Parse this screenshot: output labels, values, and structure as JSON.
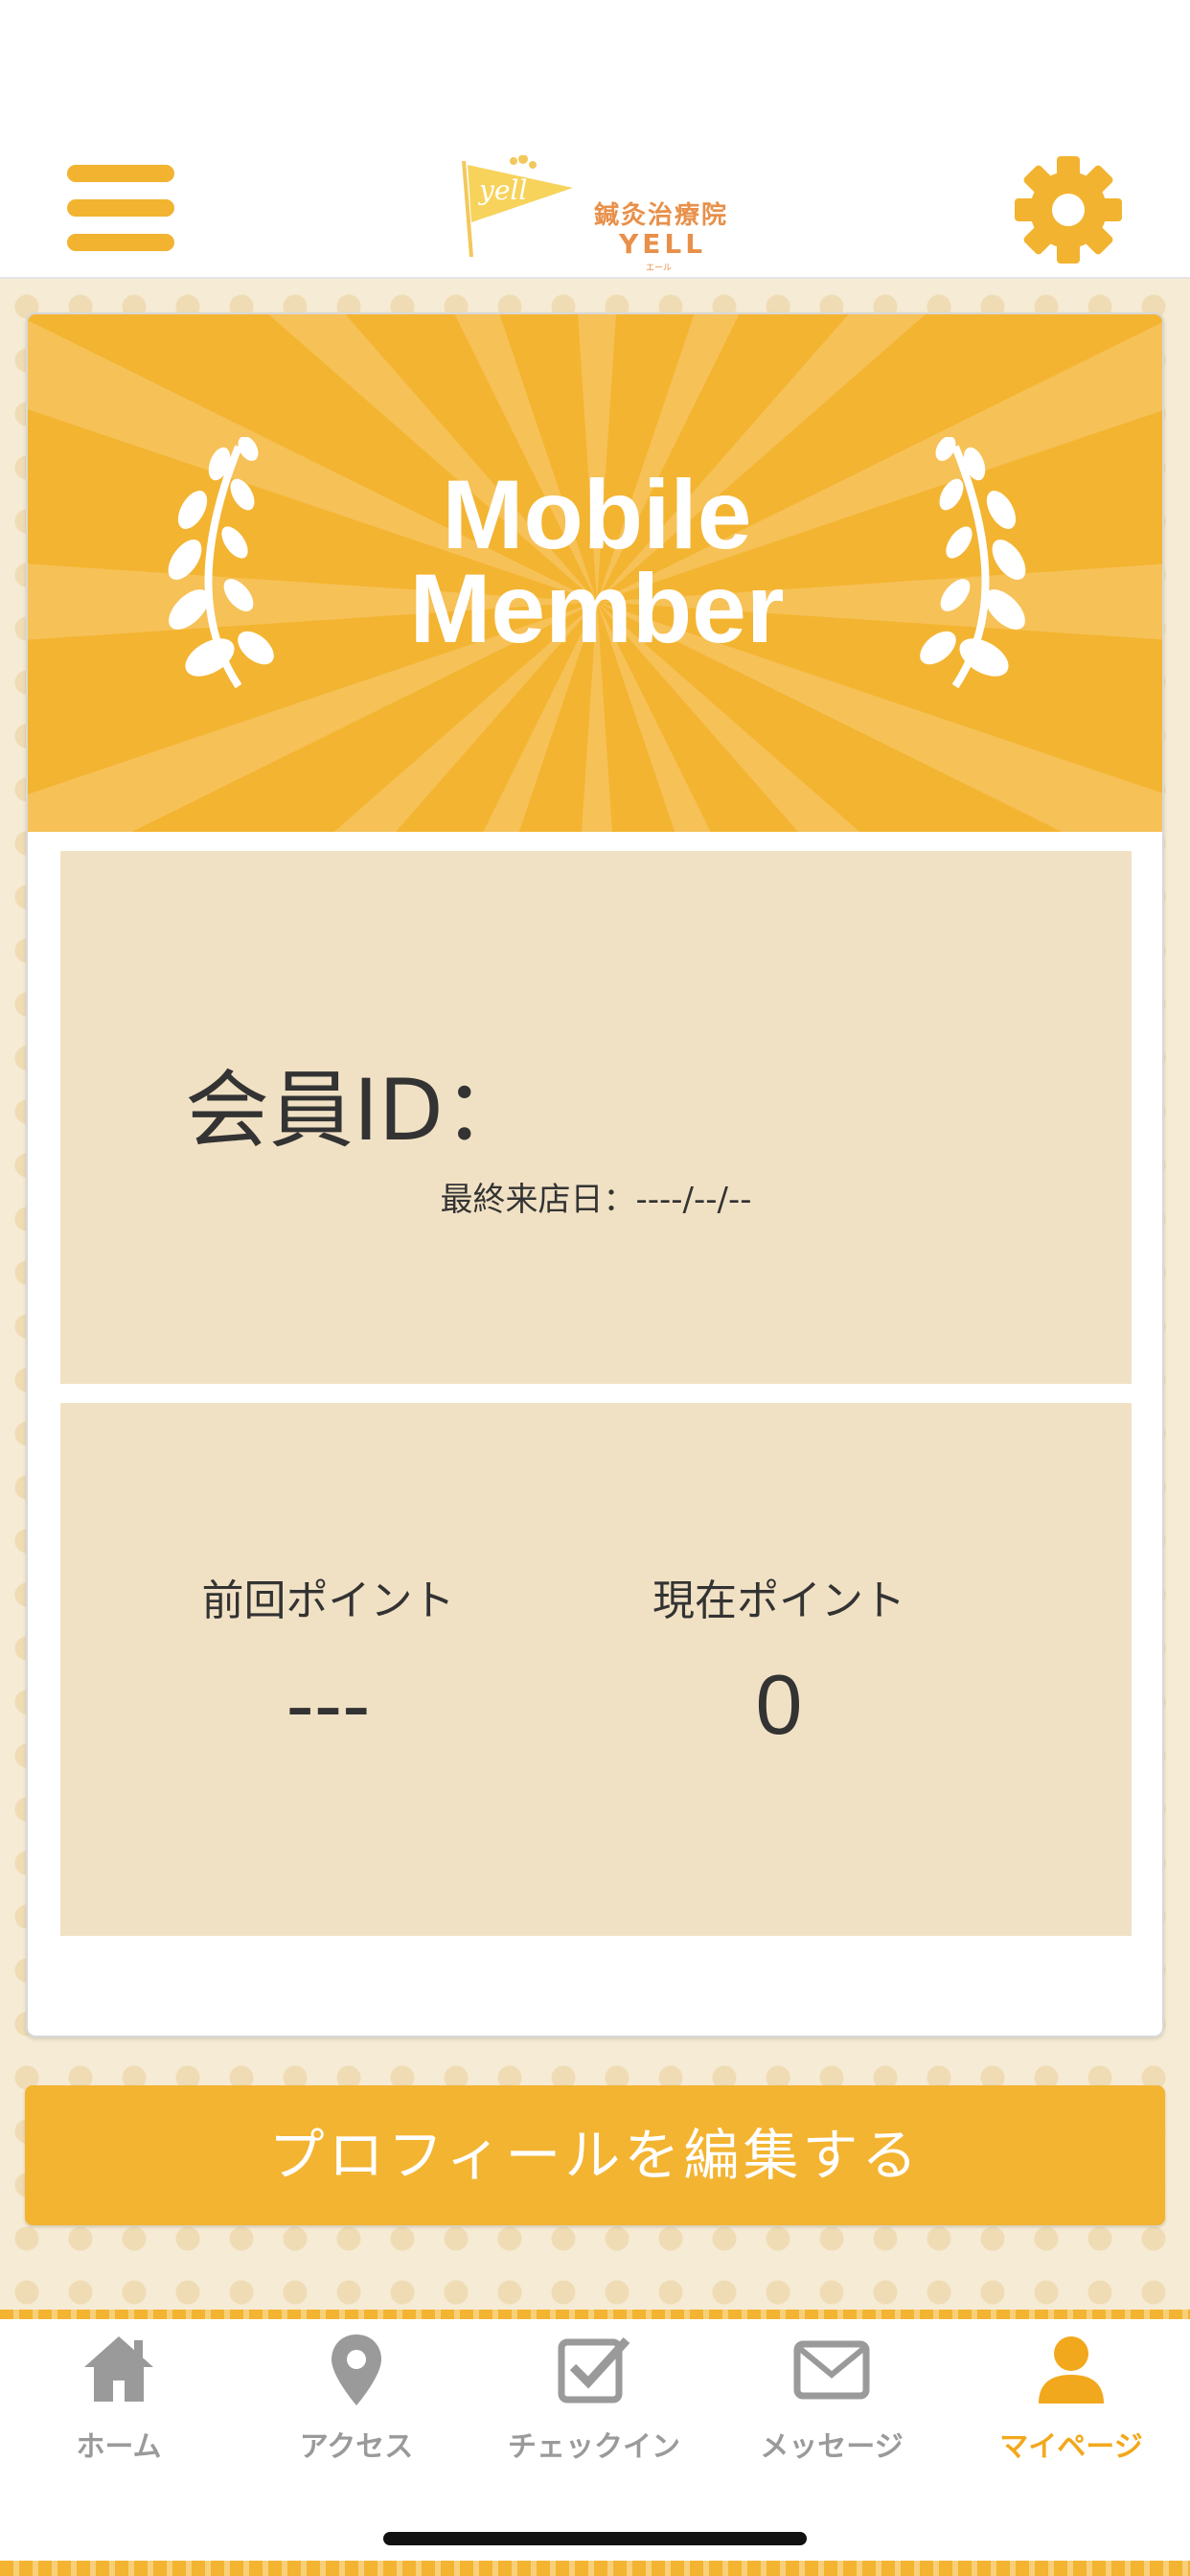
{
  "app": {
    "logo_jp": "鍼灸治療院",
    "logo_en": "YELL",
    "logo_kana": "エール",
    "logo_mark_text": "yell"
  },
  "banner": {
    "line1": "Mobile",
    "line2": "Member"
  },
  "member": {
    "id_label": "会員ID：",
    "last_visit": "最終来店日：----/--/--"
  },
  "points": {
    "previous_label": "前回ポイント",
    "previous_value": "---",
    "current_label": "現在ポイント",
    "current_value": "0"
  },
  "actions": {
    "edit_profile": "プロフィールを編集する"
  },
  "tabs": [
    {
      "label": "ホーム",
      "icon": "home-icon"
    },
    {
      "label": "アクセス",
      "icon": "map-pin-icon"
    },
    {
      "label": "チェックイン",
      "icon": "checkin-icon"
    },
    {
      "label": "メッセージ",
      "icon": "mail-icon"
    },
    {
      "label": "マイページ",
      "icon": "user-icon",
      "active": true
    }
  ],
  "colors": {
    "accent": "#f3b431",
    "panel": "#f1e1c4",
    "background": "#f6ebd4",
    "tab_inactive": "#9a9a9a",
    "tab_active": "#f2a81c"
  }
}
